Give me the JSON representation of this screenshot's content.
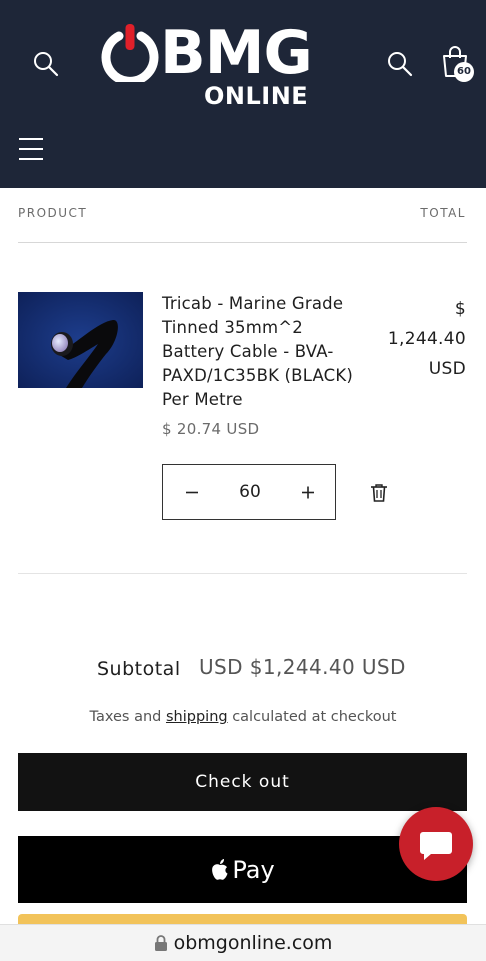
{
  "header": {
    "logo_main": "BMG",
    "logo_sub": "ONLINE",
    "cart_count": "60"
  },
  "table": {
    "col_product": "PRODUCT",
    "col_total": "TOTAL"
  },
  "item": {
    "name": "Tricab - Marine Grade Tinned 35mm^2 Battery Cable - BVA-PAXD/1C35BK (BLACK) Per Metre",
    "total_line1": "$",
    "total_line2": "1,244.40",
    "total_line3": "USD",
    "unit_price": "$ 20.74 USD",
    "quantity": "60"
  },
  "summary": {
    "subtotal_label": "Subtotal",
    "subtotal_value": "USD $1,244.40 USD",
    "tax_before": "Taxes and ",
    "tax_link": "shipping",
    "tax_after": " calculated at checkout"
  },
  "buttons": {
    "checkout": "Check out",
    "applepay": "Pay"
  },
  "browser": {
    "url": "obmgonline.com"
  },
  "colors": {
    "header_bg": "#1e2638",
    "brand_red": "#e0202a",
    "chat_red": "#c8202a"
  }
}
